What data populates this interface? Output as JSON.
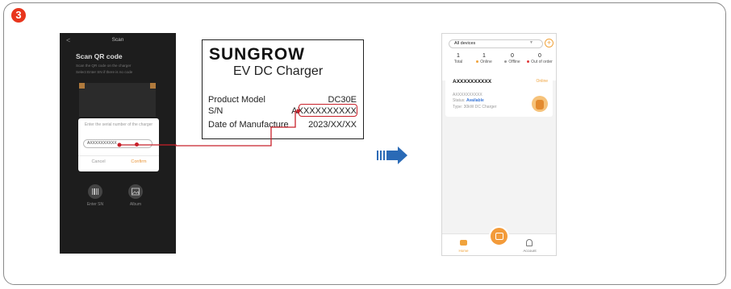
{
  "step_number": "3",
  "scan_screen": {
    "back": "<",
    "title": "Scan",
    "heading": "Scan QR code",
    "instruction_1": "Scan the QR code on the charger",
    "instruction_2": "Select Enter SN if there is no code",
    "dialog": {
      "prompt": "Enter the serial number of the charger",
      "input_value": "AXXXXXXXXXX",
      "cancel": "Cancel",
      "confirm": "Confirm"
    },
    "enter_sn_label": "Enter SN",
    "album_label": "Album"
  },
  "nameplate": {
    "brand": "SUNGROW",
    "subtitle": "EV DC Charger",
    "model_label": "Product Model",
    "model_value": "DC30E",
    "sn_label": "S/N",
    "sn_value": "AXXXXXXXXXX",
    "date_label": "Date of Manufacture",
    "date_value": "2023/XX/XX"
  },
  "devices_screen": {
    "selector": "All devices",
    "add_icon": "plus-icon",
    "stats": [
      {
        "value": "1",
        "label": "Total"
      },
      {
        "value": "1",
        "label": "Online",
        "color": "#f0a33c"
      },
      {
        "value": "0",
        "label": "Offline",
        "color": "#9a9a9a"
      },
      {
        "value": "0",
        "label": "Out of order",
        "color": "#e0393a"
      }
    ],
    "device": {
      "name": "AXXXXXXXXXX",
      "status_badge": "Online",
      "serial": "AXXXXXXXXXX",
      "status_label": "Status:",
      "status_value": "Available",
      "type": "Type: 30kW DC Charger"
    },
    "tabs": {
      "home": "Home",
      "account": "Account"
    }
  },
  "colors": {
    "accent": "#f0a33c",
    "highlight": "#c8202a",
    "arrow": "#2a6ab6"
  }
}
